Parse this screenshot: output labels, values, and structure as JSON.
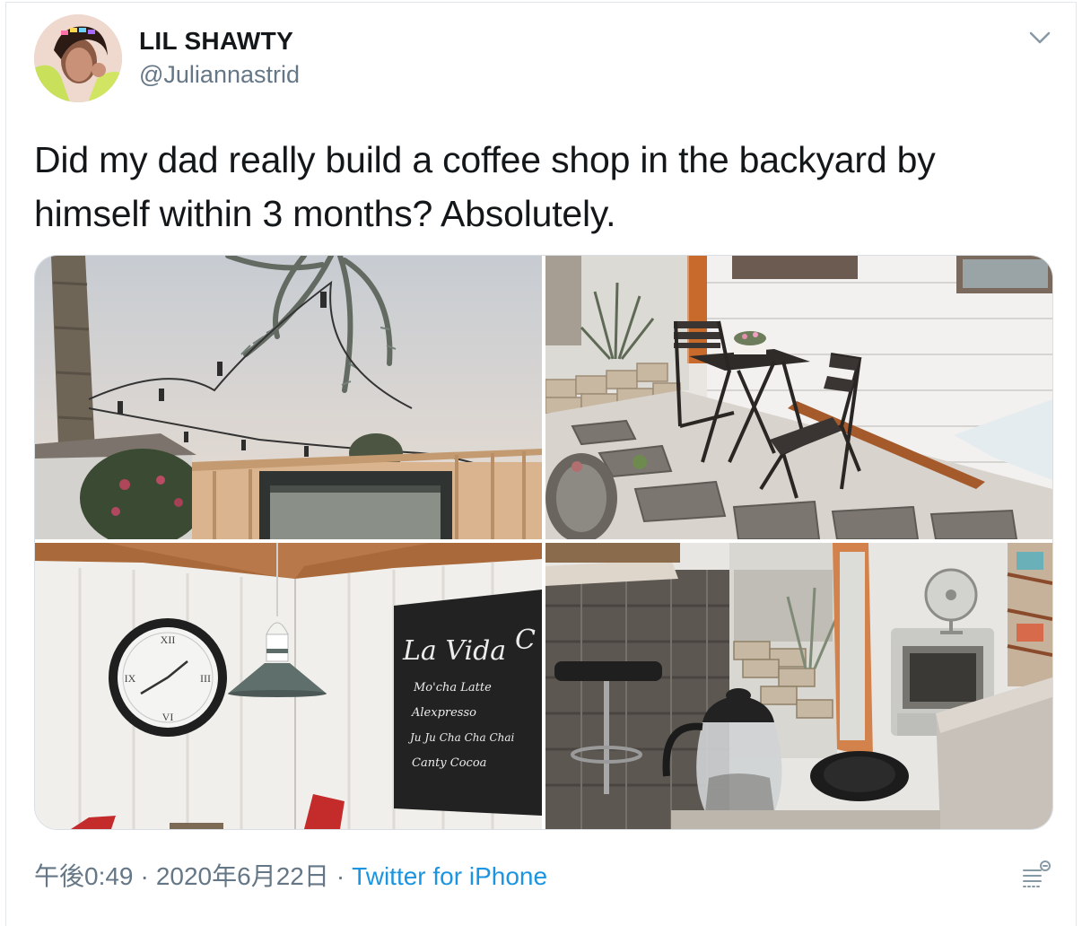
{
  "tweet": {
    "display_name": "LIL SHAWTY",
    "handle": "@Juliannastrid",
    "text": "Did my dad really build a coffee shop in the backyard by himself within 3 months? Absolutely.",
    "time": "午後0:49",
    "separator": "·",
    "date": "2020年6月22日",
    "source": "Twitter for iPhone"
  },
  "icons": {
    "menu": "chevron-down-icon",
    "stats": "analytics-icon"
  },
  "chalkboard": {
    "title": "La Vida",
    "title_cut": "C",
    "items": [
      "Mo'cha Latte",
      "Alexpresso",
      "Ju Ju Cha Cha Chai",
      "Canty Cocoa"
    ]
  },
  "colors": {
    "text": "#14171a",
    "secondary": "#657786",
    "link": "#1b95e0",
    "border": "#e1e8ed"
  }
}
